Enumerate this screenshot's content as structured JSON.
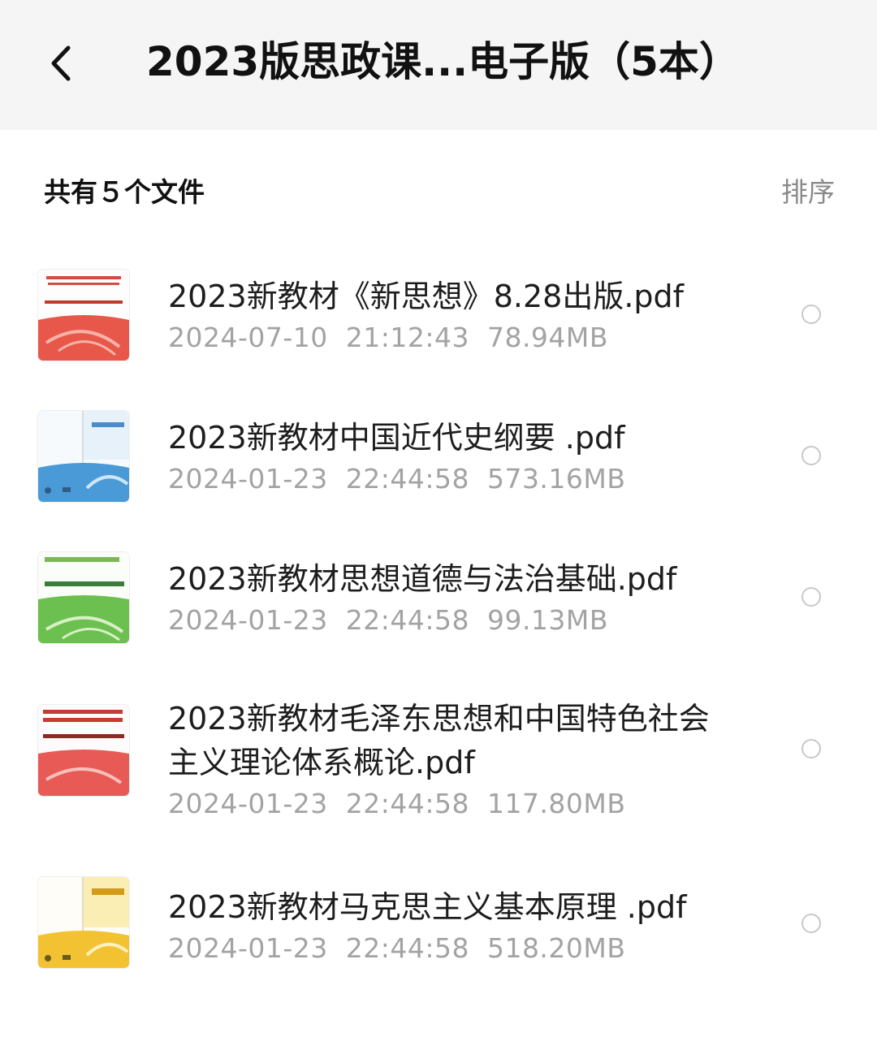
{
  "header": {
    "title": "2023版思政课...电子版（5本）"
  },
  "toolbar": {
    "count_label": "共有５个文件",
    "sort_label": "排序"
  },
  "files": [
    {
      "name": "2023新教材《新思想》8.28出版.pdf",
      "meta": "2024-07-10  21:12:43  78.94MB",
      "thumb_color": "#e8584a"
    },
    {
      "name": "2023新教材中国近代史纲要 .pdf",
      "meta": "2024-01-23  22:44:58  573.16MB",
      "thumb_color": "#4a9ad8"
    },
    {
      "name": "2023新教材思想道德与法治基础.pdf",
      "meta": "2024-01-23  22:44:58  99.13MB",
      "thumb_color": "#6cc050"
    },
    {
      "name": "2023新教材毛泽东思想和中国特色社会主义理论体系概论.pdf",
      "meta": "2024-01-23  22:44:58  117.80MB",
      "thumb_color": "#e85a55"
    },
    {
      "name": "2023新教材马克思主义基本原理 .pdf",
      "meta": "2024-01-23  22:44:58  518.20MB",
      "thumb_color": "#f2c233"
    }
  ]
}
